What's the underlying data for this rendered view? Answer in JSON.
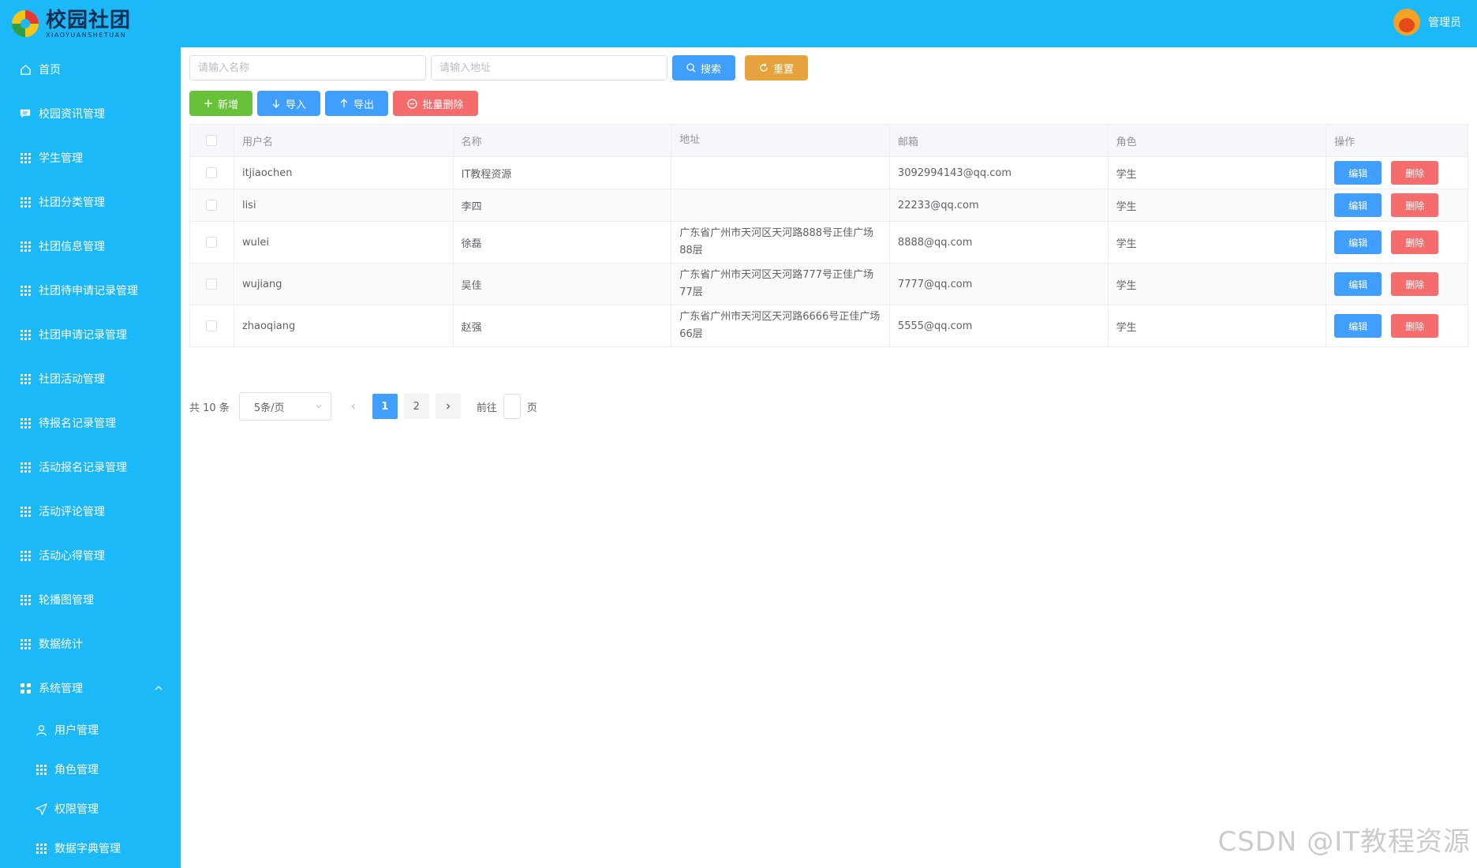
{
  "header": {
    "logo_title": "校园社团",
    "logo_sub": "XIAOYUANSHETUAN",
    "user_name": "管理员"
  },
  "sidebar": {
    "items": [
      {
        "label": "首页",
        "icon": "home-icon"
      },
      {
        "label": "校园资讯管理",
        "icon": "message-icon"
      },
      {
        "label": "学生管理",
        "icon": "grid-icon"
      },
      {
        "label": "社团分类管理",
        "icon": "grid-icon"
      },
      {
        "label": "社团信息管理",
        "icon": "grid-icon"
      },
      {
        "label": "社团待申请记录管理",
        "icon": "grid-icon"
      },
      {
        "label": "社团申请记录管理",
        "icon": "grid-icon"
      },
      {
        "label": "社团活动管理",
        "icon": "grid-icon"
      },
      {
        "label": "待报名记录管理",
        "icon": "grid-icon"
      },
      {
        "label": "活动报名记录管理",
        "icon": "grid-icon"
      },
      {
        "label": "活动评论管理",
        "icon": "grid-icon"
      },
      {
        "label": "活动心得管理",
        "icon": "grid-icon"
      },
      {
        "label": "轮播图管理",
        "icon": "grid-icon"
      },
      {
        "label": "数据统计",
        "icon": "grid-icon"
      }
    ],
    "system": {
      "label": "系统管理",
      "icon": "menu-icon"
    },
    "sub_items": [
      {
        "label": "用户管理",
        "icon": "user-icon"
      },
      {
        "label": "角色管理",
        "icon": "grid-icon"
      },
      {
        "label": "权限管理",
        "icon": "send-icon"
      },
      {
        "label": "数据字典管理",
        "icon": "grid-icon"
      }
    ]
  },
  "search": {
    "name_placeholder": "请输入名称",
    "address_placeholder": "请输入地址",
    "search_label": "搜索",
    "reset_label": "重置"
  },
  "toolbar": {
    "add_label": "新增",
    "import_label": "导入",
    "export_label": "导出",
    "batch_delete_label": "批量删除"
  },
  "table": {
    "headers": [
      "用户名",
      "名称",
      "地址",
      "邮箱",
      "角色",
      "操作"
    ],
    "edit_label": "编辑",
    "delete_label": "删除",
    "rows": [
      {
        "username": "itjiaochen",
        "name": "IT教程资源",
        "address": "",
        "email": "3092994143@qq.com",
        "role": "学生"
      },
      {
        "username": "lisi",
        "name": "李四",
        "address": "",
        "email": "22233@qq.com",
        "role": "学生"
      },
      {
        "username": "wulei",
        "name": "徐磊",
        "address": "广东省广州市天河区天河路888号正佳广场88层",
        "email": "8888@qq.com",
        "role": "学生"
      },
      {
        "username": "wujiang",
        "name": "吴佳",
        "address": "广东省广州市天河区天河路777号正佳广场77层",
        "email": "7777@qq.com",
        "role": "学生"
      },
      {
        "username": "zhaoqiang",
        "name": "赵强",
        "address": "广东省广州市天河区天河路6666号正佳广场66层",
        "email": "5555@qq.com",
        "role": "学生"
      }
    ]
  },
  "pagination": {
    "total": "共 10 条",
    "page_size": "5条/页",
    "pages": [
      "1",
      "2"
    ],
    "current": "1",
    "goto_prefix": "前往",
    "goto_suffix": "页"
  },
  "watermark": "CSDN @IT教程资源",
  "colors": {
    "brand": "#1bb9f7",
    "primary": "#409eff",
    "warning": "#e6a23c",
    "success": "#67c23a",
    "danger": "#f56c6c"
  }
}
